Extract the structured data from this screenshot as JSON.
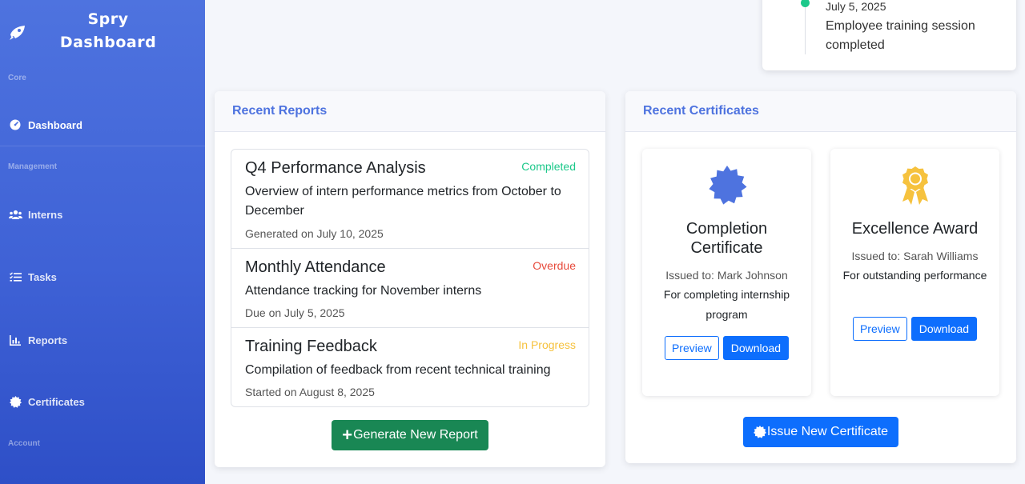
{
  "brand": {
    "line1": "Spry",
    "line2": "Dashboard",
    "icon": "rocket-icon"
  },
  "sidebar": {
    "sections": {
      "core": "Core",
      "management": "Management",
      "account": "Account"
    },
    "items": [
      {
        "label": "Dashboard",
        "icon": "dashboard-gauge-icon",
        "active": true
      },
      {
        "label": "Interns",
        "icon": "users-icon",
        "active": false
      },
      {
        "label": "Tasks",
        "icon": "tasks-list-icon",
        "active": false
      },
      {
        "label": "Reports",
        "icon": "chart-bar-icon",
        "active": false
      },
      {
        "label": "Certificates",
        "icon": "certificate-icon",
        "active": false
      }
    ]
  },
  "activity": {
    "date": "July 5, 2025",
    "text": "Employee training session completed"
  },
  "reports": {
    "header": "Recent Reports",
    "items": [
      {
        "title": "Q4 Performance Analysis",
        "status": "Completed",
        "status_color": "#1cc88a",
        "description": "Overview of intern performance metrics from October to December",
        "meta": "Generated on July 10, 2025"
      },
      {
        "title": "Monthly Attendance",
        "status": "Overdue",
        "status_color": "#e74a3b",
        "description": "Attendance tracking for November interns",
        "meta": "Due on July 5, 2025"
      },
      {
        "title": "Training Feedback",
        "status": "In Progress",
        "status_color": "#f6c23e",
        "description": "Compilation of feedback from recent technical training",
        "meta": "Started on August 8, 2025"
      }
    ],
    "generate_button": "Generate New Report"
  },
  "certificates": {
    "header": "Recent Certificates",
    "items": [
      {
        "title": "Completion Certificate",
        "icon": "certificate-seal-icon",
        "icon_color": "#4e73df",
        "issued_to": "Issued to: Mark Johnson",
        "description": "For completing internship program",
        "preview_label": "Preview",
        "download_label": "Download"
      },
      {
        "title": "Excellence Award",
        "icon": "award-medal-icon",
        "icon_color": "#f6c23e",
        "issued_to": "Issued to: Sarah Williams",
        "description": "For outstanding performance",
        "preview_label": "Preview",
        "download_label": "Download"
      }
    ],
    "issue_button": "Issue New Certificate"
  }
}
